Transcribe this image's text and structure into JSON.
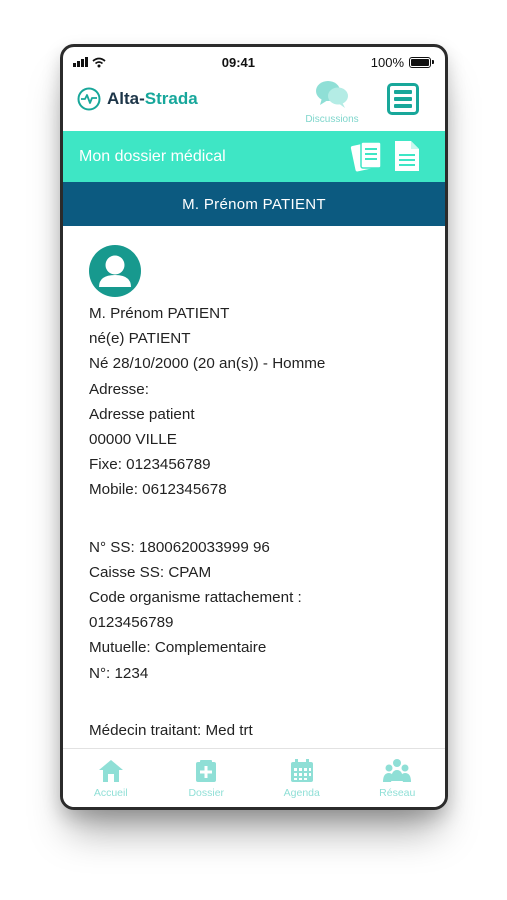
{
  "status_bar": {
    "time": "09:41",
    "battery": "100%"
  },
  "header": {
    "brand_part1": "Alta-",
    "brand_part2": "Strada",
    "discussions_label": "Discussions"
  },
  "section": {
    "title": "Mon dossier médical"
  },
  "patient_bar": {
    "name": "M. Prénom PATIENT"
  },
  "patient": {
    "lines_identity": [
      "M. Prénom PATIENT",
      "né(e) PATIENT",
      "Né 28/10/2000 (20 an(s)) - Homme",
      "Adresse:",
      "Adresse patient",
      "00000 VILLE",
      "Fixe: 0123456789",
      "Mobile: 0612345678"
    ],
    "lines_insurance": [
      "N° SS: 1800620033999 96",
      "Caisse SS: CPAM",
      "Code organisme rattachement :",
      "0123456789",
      "Mutuelle: Complementaire",
      "N°: 1234"
    ],
    "lines_doctor": [
      "Médecin traitant: Med trt"
    ]
  },
  "tabbar": {
    "home": "Accueil",
    "folder": "Dossier",
    "agenda": "Agenda",
    "network": "Réseau"
  },
  "colors": {
    "accent": "#18a79a",
    "section_bar": "#3ee6c5",
    "patient_bar": "#0c5a80",
    "tab_inactive": "#8fdfd6"
  }
}
